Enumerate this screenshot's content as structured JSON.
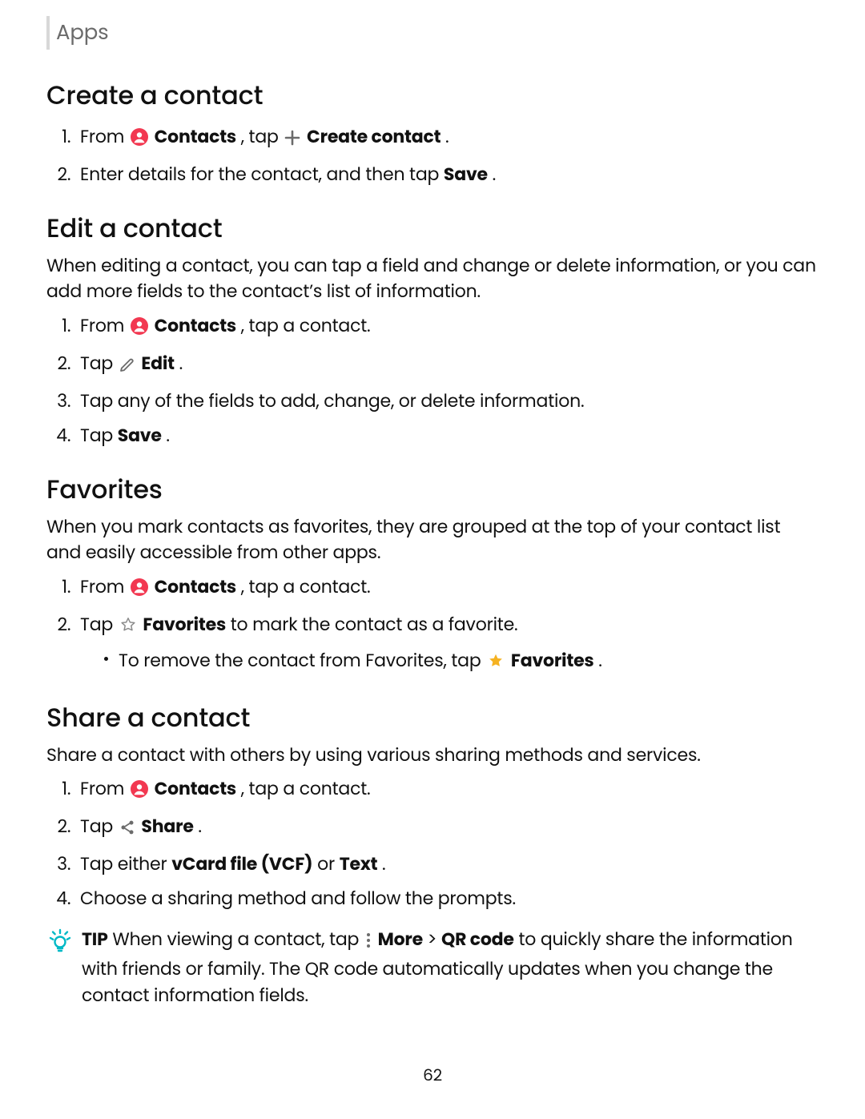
{
  "breadcrumb": "Apps",
  "page_number": "62",
  "sections": {
    "create": {
      "title": "Create a contact",
      "step1_pre": "From ",
      "step1_contacts": "Contacts",
      "step1_mid": ", tap ",
      "step1_action": "Create contact",
      "step1_post": ".",
      "step2_pre": "Enter details for the contact, and then tap ",
      "step2_save": "Save",
      "step2_post": "."
    },
    "edit": {
      "title": "Edit a contact",
      "lead": "When editing a contact, you can tap a field and change or delete information, or you can add more fields to the contact’s list of information.",
      "s1_pre": "From ",
      "s1_contacts": "Contacts",
      "s1_post": ", tap a contact.",
      "s2_pre": "Tap ",
      "s2_edit": "Edit",
      "s2_post": ".",
      "s3": "Tap any of the fields to add, change, or delete information.",
      "s4_pre": "Tap ",
      "s4_save": "Save",
      "s4_post": "."
    },
    "favorites": {
      "title": "Favorites",
      "lead": "When you mark contacts as favorites, they are grouped at the top of your contact list and easily accessible from other apps.",
      "s1_pre": "From ",
      "s1_contacts": "Contacts",
      "s1_post": ", tap a contact.",
      "s2_pre": "Tap ",
      "s2_fav": "Favorites",
      "s2_post": " to mark the contact as a favorite.",
      "sub_pre": "To remove the contact from Favorites, tap ",
      "sub_fav": "Favorites",
      "sub_post": "."
    },
    "share": {
      "title": "Share a contact",
      "lead": "Share a contact with others by using various sharing methods and services.",
      "s1_pre": "From ",
      "s1_contacts": "Contacts",
      "s1_post": ", tap a contact.",
      "s2_pre": "Tap ",
      "s2_share": "Share",
      "s2_post": ".",
      "s3_pre": "Tap either ",
      "s3_vcf": "vCard file (VCF)",
      "s3_mid": " or ",
      "s3_text": "Text",
      "s3_post": ".",
      "s4": "Choose a sharing method and follow the prompts."
    },
    "tip": {
      "label": "TIP",
      "t1": "  When viewing a contact, tap ",
      "more": "More",
      "gt": " > ",
      "qr": "QR code",
      "t2": " to quickly share the information with friends or family. The QR code automatically updates when you change the contact information fields."
    }
  }
}
